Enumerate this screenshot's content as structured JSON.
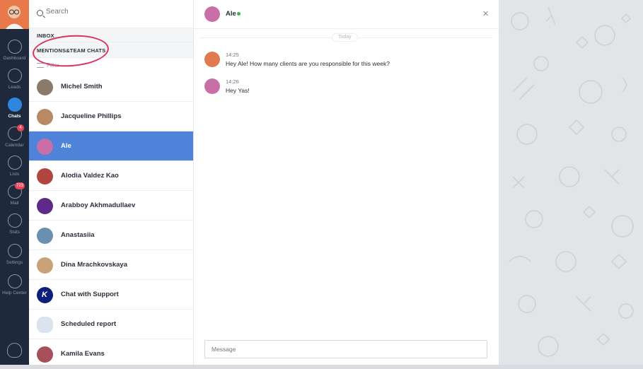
{
  "nav": {
    "items": [
      {
        "label": "Dashboard",
        "icon": "speedometer-icon",
        "active": false,
        "badge": ""
      },
      {
        "label": "Leads",
        "icon": "dollar-icon",
        "active": false,
        "badge": ""
      },
      {
        "label": "Chats",
        "icon": "chat-bubble-icon",
        "active": true,
        "badge": ""
      },
      {
        "label": "Calendar",
        "icon": "check-circle-icon",
        "active": false,
        "badge": "4"
      },
      {
        "label": "Lists",
        "icon": "list-icon",
        "active": false,
        "badge": ""
      },
      {
        "label": "Mail",
        "icon": "mail-icon",
        "active": false,
        "badge": "723"
      },
      {
        "label": "Stats",
        "icon": "chart-line-icon",
        "active": false,
        "badge": ""
      },
      {
        "label": "Settings",
        "icon": "wrench-icon",
        "active": false,
        "badge": ""
      },
      {
        "label": "Help Center",
        "icon": "help-icon",
        "active": false,
        "badge": ""
      }
    ]
  },
  "list": {
    "search_placeholder": "Search",
    "inbox_label": "INBOX",
    "mentions_label": "MENTIONS&TEAM CHATS",
    "filter_label": "Filter",
    "chats": [
      {
        "name": "Michel Smith",
        "avatar_color": "#8a7a6a",
        "active": false
      },
      {
        "name": "Jacqueline Phillips",
        "avatar_color": "#b78a63",
        "active": false
      },
      {
        "name": "Ale",
        "avatar_color": "#c76fa6",
        "active": true
      },
      {
        "name": "Alodia Valdez Kao",
        "avatar_color": "#b0463f",
        "active": false
      },
      {
        "name": "Arabboy Akhmadullaev",
        "avatar_color": "#5d2a8a",
        "active": false
      },
      {
        "name": "Anastasiia",
        "avatar_color": "#6b8fb0",
        "active": false
      },
      {
        "name": "Dina Mrachkovskaya",
        "avatar_color": "#c9a27a",
        "active": false
      },
      {
        "name": "Chat with Support",
        "avatar_color": "#0c1f7a",
        "active": false
      },
      {
        "name": "Scheduled report",
        "avatar_color": "#dbe4ee",
        "active": false
      },
      {
        "name": "Kamila Evans",
        "avatar_color": "#a8505a",
        "active": false
      }
    ]
  },
  "chat": {
    "contact_name": "Ale",
    "online_color": "#3bb54a",
    "close_glyph": "×",
    "day_divider": "Today",
    "messages": [
      {
        "time": "14:25",
        "text": "Hey Ale! How many clients are you responsible for this week?",
        "avatar_color": "#e07a50"
      },
      {
        "time": "14:26",
        "text": "Hey Yas!",
        "avatar_color": "#c76fa6"
      }
    ],
    "composer_placeholder": "Message"
  },
  "colors": {
    "nav_bg": "#1e2a3c",
    "accent": "#4f82d9",
    "annotation": "#d9345c"
  }
}
